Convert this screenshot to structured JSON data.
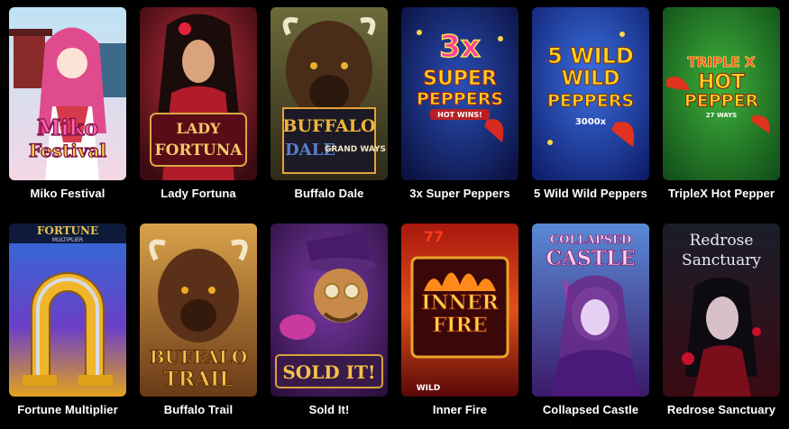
{
  "games": [
    {
      "title": "Miko Festival",
      "logo_lines": [
        "Miko",
        "Festival"
      ]
    },
    {
      "title": "Lady Fortuna",
      "logo_lines": [
        "LADY",
        "FORTUNA"
      ]
    },
    {
      "title": "Buffalo Dale",
      "logo_lines": [
        "BUFFALO",
        "DALE",
        "GRAND WAYS"
      ]
    },
    {
      "title": "3x Super Peppers",
      "logo_lines": [
        "3x",
        "SUPER",
        "PEPPERS",
        "HOT WINS!"
      ]
    },
    {
      "title": "5 Wild Wild Peppers",
      "logo_lines": [
        "5 WILD",
        "WILD",
        "PEPPERS",
        "3000x"
      ]
    },
    {
      "title": "TripleX Hot Pepper",
      "logo_lines": [
        "TRIPLE X",
        "HOT",
        "PEPPER",
        "27 WAYS"
      ]
    },
    {
      "title": "Fortune Multiplier",
      "logo_lines": [
        "FORTUNE",
        "MULTIPLIER"
      ]
    },
    {
      "title": "Buffalo Trail",
      "logo_lines": [
        "BUFFALO",
        "TRAIL"
      ]
    },
    {
      "title": "Sold It!",
      "logo_lines": [
        "SOLD IT!"
      ]
    },
    {
      "title": "Inner Fire",
      "logo_lines": [
        "INNER",
        "FIRE",
        "WILD"
      ]
    },
    {
      "title": "Collapsed Castle",
      "logo_lines": [
        "COLLAPSED",
        "CASTLE"
      ]
    },
    {
      "title": "Redrose Sanctuary",
      "logo_lines": [
        "Redrose",
        "Sanctuary"
      ]
    }
  ]
}
